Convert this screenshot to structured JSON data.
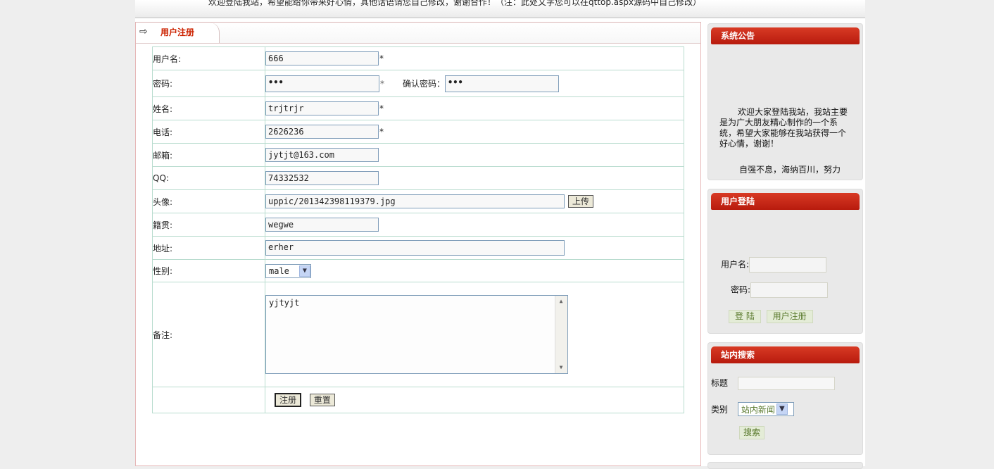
{
  "header": {
    "notice": "欢迎登陆我站，希望能给你带来好心情，其他话语请您自己修改，谢谢合作！（注：此处文字您可以在qttop.aspx源码中自己修改）"
  },
  "register": {
    "tab_label": "用户注册",
    "fields": {
      "username": {
        "label": "用户名:",
        "value": "666"
      },
      "password": {
        "label": "密码:",
        "value": "•••"
      },
      "confirm": {
        "label": "确认密码：",
        "value": "•••"
      },
      "realname": {
        "label": "姓名:",
        "value": "trjtrjr"
      },
      "phone": {
        "label": "电话:",
        "value": "2626236"
      },
      "email": {
        "label": "邮箱:",
        "value": "jytjt@163.com"
      },
      "qq": {
        "label": "QQ:",
        "value": "74332532"
      },
      "avatar": {
        "label": "头像:",
        "value": "uppic/201342398119379.jpg"
      },
      "hometown": {
        "label": "籍贯:",
        "value": "wegwe"
      },
      "address": {
        "label": "地址:",
        "value": "erher"
      },
      "gender": {
        "label": "性别:",
        "value": "male"
      },
      "remark": {
        "label": "备注:",
        "value": "yjtyjt"
      }
    },
    "required_mark": "*",
    "upload_label": "上传",
    "submit_label": "注册",
    "reset_label": "重置"
  },
  "sidebar": {
    "announcement": {
      "title": "系统公告",
      "text": "欢迎大家登陆我站，我站主要是为广大朋友精心制作的一个系统，希望大家能够在我站获得一个好心情，谢谢！",
      "motto": "自强不息，海纳百川，努力"
    },
    "login": {
      "title": "用户登陆",
      "username_label": "用户名:",
      "password_label": "密码:",
      "login_button": "登 陆",
      "register_button": "用户注册"
    },
    "search": {
      "title": "站内搜索",
      "title_label": "标题",
      "category_label": "类别",
      "category_value": "站内新闻",
      "search_button": "搜索"
    }
  }
}
